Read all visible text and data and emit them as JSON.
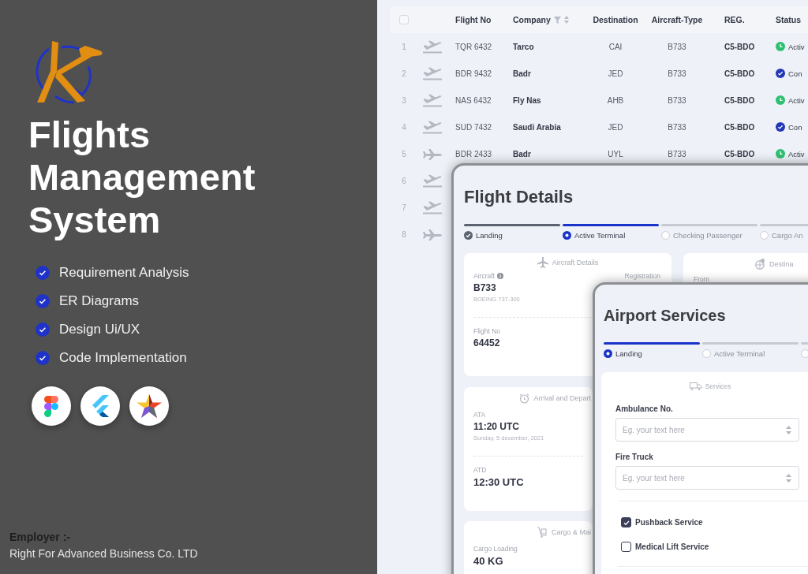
{
  "sidebar": {
    "title": "Flights Management System",
    "features": [
      {
        "label": "Requirement Analysis",
        "checked": true
      },
      {
        "label": "ER Diagrams",
        "checked": true
      },
      {
        "label": "Design Ui/UX",
        "checked": true
      },
      {
        "label": "Code Implementation",
        "checked": true
      }
    ],
    "tools": [
      {
        "kind": "shapes"
      },
      {
        "kind": "wing"
      },
      {
        "kind": "star"
      }
    ],
    "employer_label": "Employer :-",
    "employer": "Right For Advanced Business Co. LTD"
  },
  "flights_table": {
    "select_all": {
      "checked": false
    },
    "columns": [
      {
        "label": "Flight No"
      },
      {
        "label": "Company",
        "filter": true,
        "sortable": true
      },
      {
        "label": "Destination"
      },
      {
        "label": "Aircraft-Type"
      },
      {
        "label": "REG."
      },
      {
        "label": "Status"
      }
    ],
    "rows": [
      {
        "number": "1",
        "kind": "takeoff",
        "flight_no": "TQR 6432",
        "company": "Tarco",
        "destination": "CAI",
        "aircraft_type": "B733",
        "reg": "C5-BDO",
        "status": {
          "kind": "active",
          "text": "Activ"
        }
      },
      {
        "number": "2",
        "kind": "takeoff",
        "flight_no": "BDR 9432",
        "company": "Badr",
        "destination": "JED",
        "aircraft_type": "B733",
        "reg": "C5-BDO",
        "status": {
          "kind": "completed",
          "text": "Con"
        }
      },
      {
        "number": "3",
        "kind": "takeoff",
        "flight_no": "NAS 6432",
        "company": "Fly Nas",
        "destination": "AHB",
        "aircraft_type": "B733",
        "reg": "C5-BDO",
        "status": {
          "kind": "active",
          "text": "Activ"
        }
      },
      {
        "number": "4",
        "kind": "takeoff",
        "flight_no": "SUD 7432",
        "company": "Saudi Arabia",
        "destination": "JED",
        "aircraft_type": "B733",
        "reg": "C5-BDO",
        "status": {
          "kind": "completed",
          "text": "Con"
        }
      },
      {
        "number": "5",
        "kind": "cruise",
        "flight_no": "BDR 2433",
        "company": "Badr",
        "destination": "UYL",
        "aircraft_type": "B733",
        "reg": "C5-BDO",
        "status": {
          "kind": "active",
          "text": "Activ"
        }
      },
      {
        "number": "6",
        "kind": "takeoff"
      },
      {
        "number": "7",
        "kind": "takeoff"
      },
      {
        "number": "8",
        "kind": "cruise"
      }
    ]
  },
  "flight_details": {
    "title": "Flight Details",
    "steps": [
      {
        "label": "Landing",
        "kind": "done"
      },
      {
        "label": "Active Terminal",
        "kind": "current"
      },
      {
        "label": "Checking Passenger",
        "kind": "pending"
      },
      {
        "label": "Cargo An",
        "kind": "pending"
      }
    ],
    "aircraft_card": {
      "heading": "Aircraft Details",
      "aircraft_label": "Aircraft",
      "aircraft": "B733",
      "aircraft_model": "BOEING 737-300",
      "registration_label": "Registration",
      "flight_no_label": "Flight No",
      "flight_no": "64452"
    },
    "destination_card": {
      "heading": "Destina",
      "from_label": "From"
    },
    "times_card": {
      "heading": "Arrival and Depart",
      "ata_label": "ATA",
      "ata": "11:20 UTC",
      "ata_date": "Sunday, 5 december, 2021",
      "atd_label": "ATD",
      "atd": "12:30 UTC"
    },
    "cargo_card": {
      "heading": "Cargo & Mai",
      "loading_label": "Cargo Loading",
      "loading": "40 KG"
    }
  },
  "airport_services": {
    "title": "Airport Services",
    "steps": [
      {
        "label": "Landing",
        "kind": "current"
      },
      {
        "label": "Active Terminal",
        "kind": "pending"
      },
      {
        "kind": "pending"
      }
    ],
    "services_card": {
      "heading": "Services",
      "fields": [
        {
          "label": "Ambulance No.",
          "placeholder": "Eg. your text here"
        },
        {
          "label": "Fire Truck",
          "placeholder": "Eg. your text here"
        }
      ],
      "options": [
        {
          "label": "Pushback Service",
          "checked": true
        },
        {
          "label": "Medical Lift Service",
          "checked": false
        }
      ]
    }
  }
}
